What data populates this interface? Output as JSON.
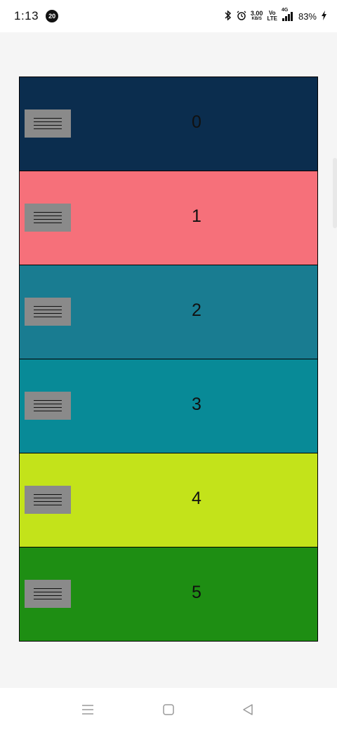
{
  "status_bar": {
    "time": "1:13",
    "notification_count": "20",
    "net_speed_value": "3.00",
    "net_speed_unit": "KB/S",
    "volte_top": "Vo",
    "volte_bottom": "LTE",
    "network_type": "4G",
    "battery": "83%"
  },
  "list": {
    "items": [
      {
        "label": "0",
        "color": "#0b2d4e"
      },
      {
        "label": "1",
        "color": "#f6707a"
      },
      {
        "label": "2",
        "color": "#197c91"
      },
      {
        "label": "3",
        "color": "#088a97"
      },
      {
        "label": "4",
        "color": "#c3e31a"
      },
      {
        "label": "5",
        "color": "#1e8e13"
      }
    ],
    "next_item_color": "#8a7a1a"
  },
  "nav_bar": {
    "buttons": [
      "recents",
      "home",
      "back"
    ]
  }
}
